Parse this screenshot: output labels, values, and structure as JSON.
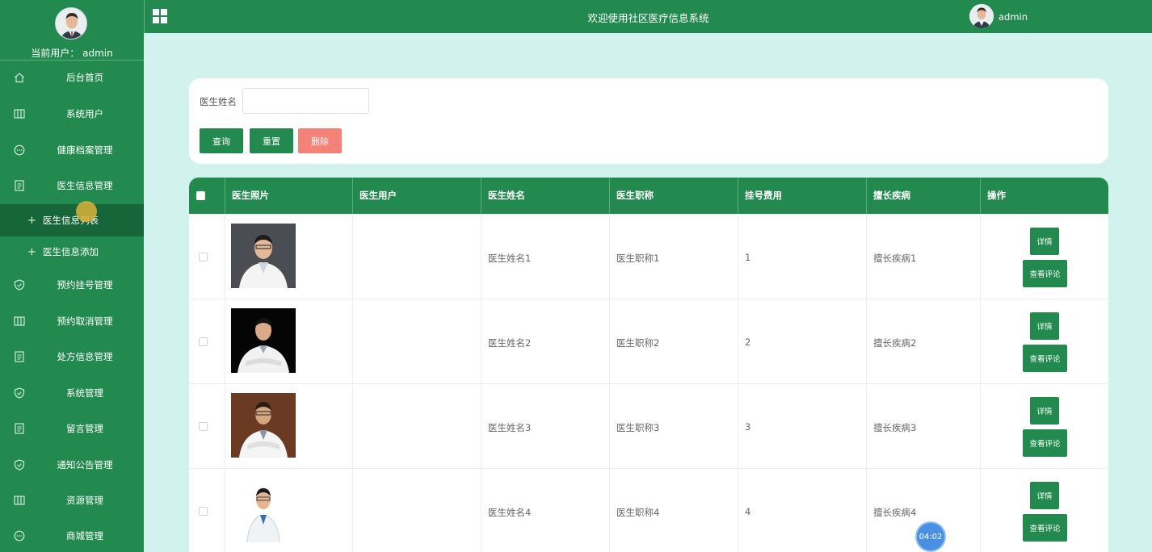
{
  "sidebar": {
    "user_prefix": "当前用户：",
    "username": "admin",
    "menu": [
      {
        "label": "后台首页",
        "icon": "home-icon"
      },
      {
        "label": "系统用户",
        "icon": "columns-icon"
      },
      {
        "label": "健康档案管理",
        "icon": "chat-icon"
      },
      {
        "label": "医生信息管理",
        "icon": "document-icon"
      },
      {
        "label": "预约挂号管理",
        "icon": "shield-icon"
      },
      {
        "label": "预约取消管理",
        "icon": "columns-icon"
      },
      {
        "label": "处方信息管理",
        "icon": "document-icon"
      },
      {
        "label": "系统管理",
        "icon": "shield-icon"
      },
      {
        "label": "留言管理",
        "icon": "document-icon"
      },
      {
        "label": "通知公告管理",
        "icon": "shield-icon"
      },
      {
        "label": "资源管理",
        "icon": "columns-icon"
      },
      {
        "label": "商城管理",
        "icon": "chat-icon"
      }
    ],
    "submenu": [
      {
        "label": "医生信息列表",
        "active": true
      },
      {
        "label": "医生信息添加",
        "active": false
      }
    ]
  },
  "topbar": {
    "title": "欢迎使用社区医疗信息系统",
    "username": "admin"
  },
  "search": {
    "label": "医生姓名",
    "placeholder": "",
    "value": "",
    "query_label": "查询",
    "reset_label": "重置",
    "delete_label": "删除"
  },
  "table": {
    "headers": [
      "医生照片",
      "医生用户",
      "医生姓名",
      "医生职称",
      "挂号费用",
      "擅长疾病",
      "操作"
    ],
    "rows": [
      {
        "user": "",
        "name": "医生姓名1",
        "title": "医生职称1",
        "fee": "1",
        "specialty": "擅长疾病1"
      },
      {
        "user": "",
        "name": "医生姓名2",
        "title": "医生职称2",
        "fee": "2",
        "specialty": "擅长疾病2"
      },
      {
        "user": "",
        "name": "医生姓名3",
        "title": "医生职称3",
        "fee": "3",
        "specialty": "擅长疾病3"
      },
      {
        "user": "",
        "name": "医生姓名4",
        "title": "医生职称4",
        "fee": "4",
        "specialty": "擅长疾病4"
      }
    ],
    "detail_label": "详情",
    "comment_label": "查看评论"
  },
  "timer": "04:02",
  "colors": {
    "primary": "#238a4f",
    "danger": "#f48278",
    "background": "#d2f2ee"
  }
}
